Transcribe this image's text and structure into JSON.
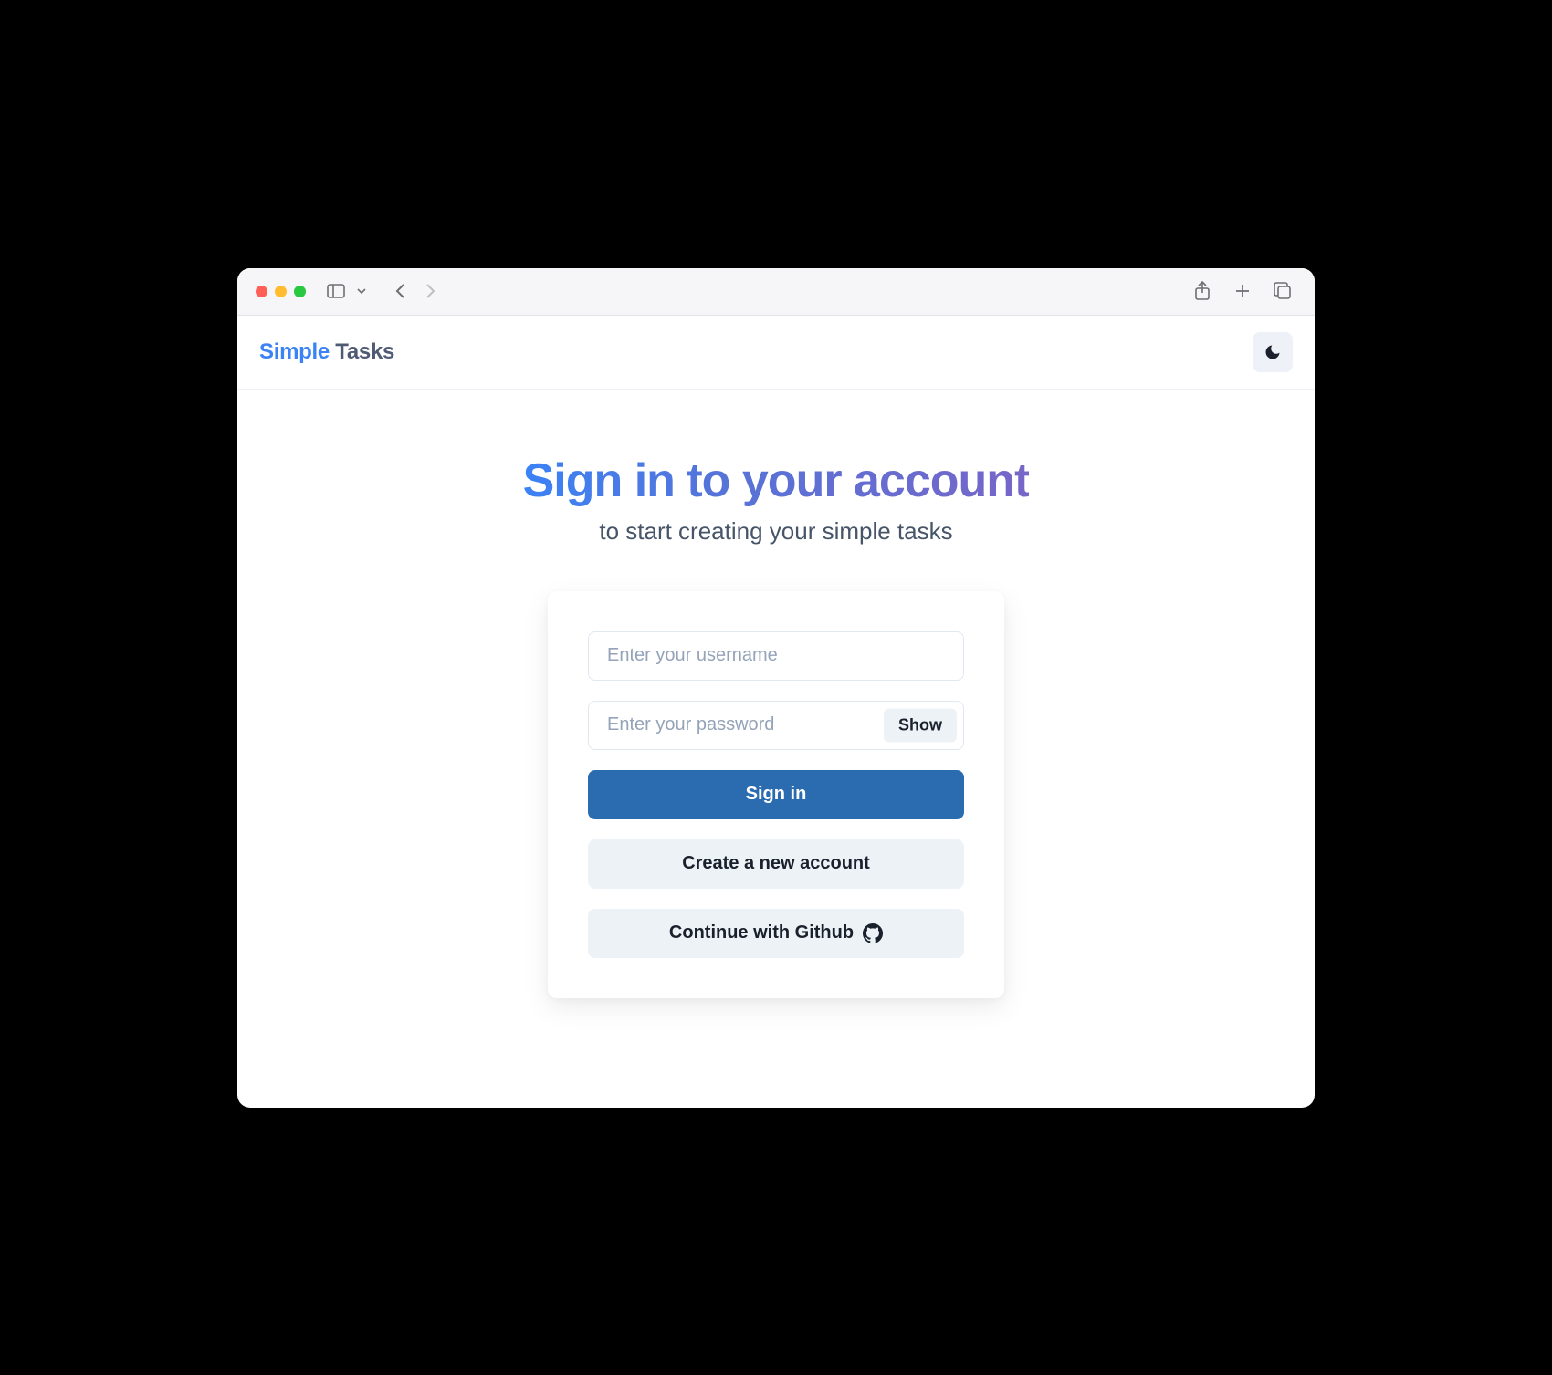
{
  "app": {
    "logo_word1": "Simple",
    "logo_word2": " Tasks"
  },
  "hero": {
    "title": "Sign in to your account",
    "subtitle": "to start creating your simple tasks"
  },
  "form": {
    "username_placeholder": "Enter your username",
    "username_value": "",
    "password_placeholder": "Enter your password",
    "password_value": "",
    "show_password_label": "Show",
    "signin_label": "Sign in",
    "create_account_label": "Create a new account",
    "github_label": "Continue with Github"
  }
}
